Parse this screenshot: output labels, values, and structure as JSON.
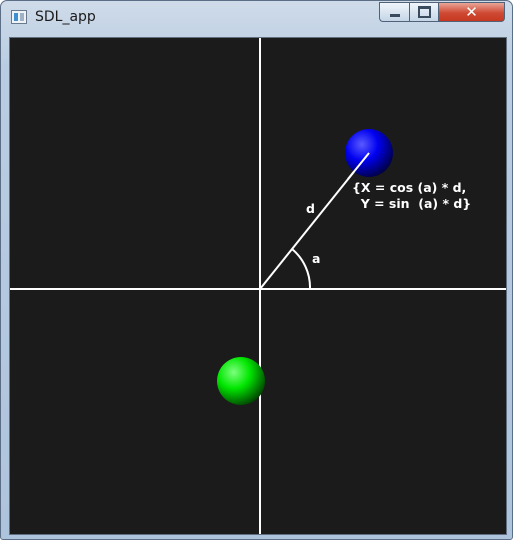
{
  "window": {
    "title": "SDL_app",
    "controls": {
      "minimize": "",
      "maximize": "",
      "close": "✕"
    }
  },
  "scene": {
    "background": "#1b1b1b",
    "axis_color": "#ffffff",
    "angle_label": "a",
    "distance_label": "d",
    "formula_line1": "{X = cos (a) * d,",
    "formula_line2": "  Y = sin  (a) * d}",
    "blue_ball_color": "#0000ff",
    "green_ball_color": "#00ff00"
  }
}
